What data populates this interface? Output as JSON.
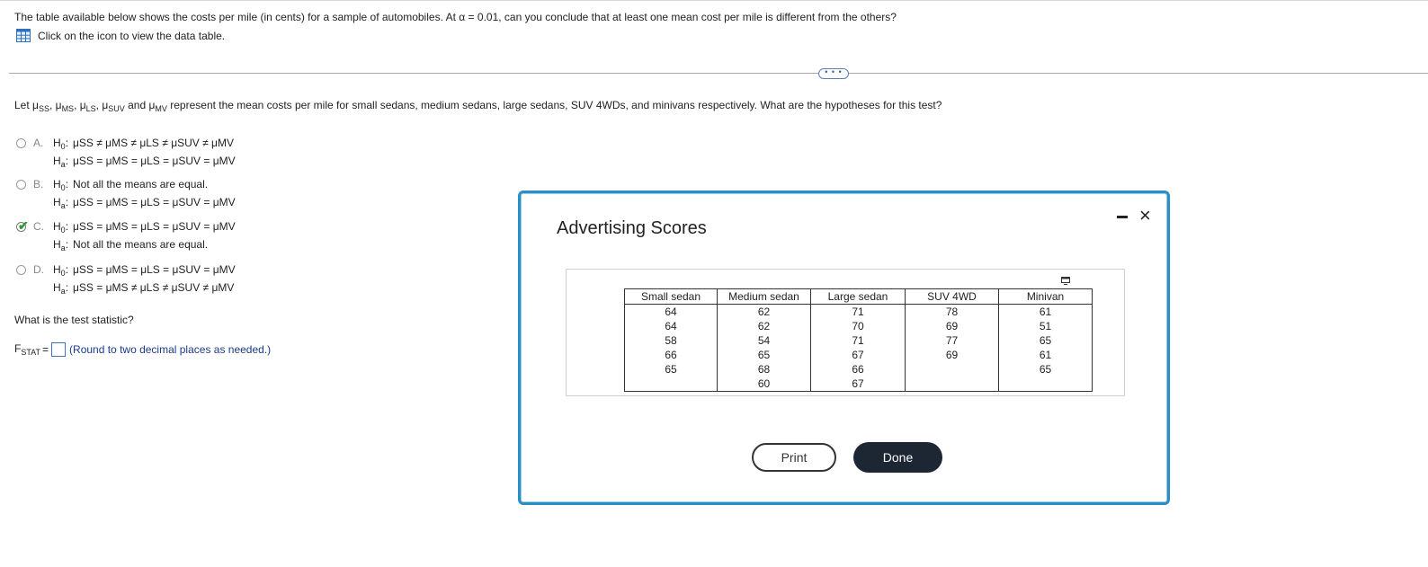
{
  "question": {
    "prefix": "The table available below shows the costs per mile (in cents) for a sample of automobiles. At",
    "alpha_symbol": "α",
    "alpha_value": "= 0.01, can you conclude that at least one mean cost per mile is different from the others?",
    "table_link": "Click on the icon to view the data table."
  },
  "let_line": {
    "start": "Let",
    "mu": "μ",
    "subs": [
      "SS",
      "MS",
      "LS",
      "SUV",
      "MV"
    ],
    "and": "and",
    "rest": "represent the mean costs per mile for small sedans, medium sedans, large sedans, SUV 4WDs, and minivans respectively. What are the hypotheses for this test?"
  },
  "options": [
    {
      "letter": "A.",
      "h0": "μSS ≠ μMS ≠ μLS ≠ μSUV ≠ μMV",
      "ha": "μSS = μMS = μLS = μSUV = μMV",
      "selected": false
    },
    {
      "letter": "B.",
      "h0": "Not all the means are equal.",
      "ha": "μSS = μMS = μLS = μSUV = μMV",
      "selected": false
    },
    {
      "letter": "C.",
      "h0": "μSS = μMS = μLS = μSUV = μMV",
      "ha": "Not all the means are equal.",
      "selected": true
    },
    {
      "letter": "D.",
      "h0": "μSS = μMS = μLS = μSUV = μMV",
      "ha": "μSS = μMS ≠ μLS ≠ μSUV ≠ μMV",
      "selected": false
    }
  ],
  "hyp_labels": {
    "h0": "H",
    "h0_sub": "0",
    "ha": "H",
    "ha_sub": "a"
  },
  "test_statistic": {
    "question": "What is the test statistic?",
    "label": "F",
    "label_sub": "STAT",
    "equals": "=",
    "note": "(Round to two decimal places as needed.)"
  },
  "modal": {
    "title": "Advertising Scores",
    "columns": [
      "Small sedan",
      "Medium sedan",
      "Large sedan",
      "SUV 4WD",
      "Minivan"
    ],
    "rows": [
      [
        "64",
        "62",
        "71",
        "78",
        "61"
      ],
      [
        "64",
        "62",
        "70",
        "69",
        "51"
      ],
      [
        "58",
        "54",
        "71",
        "77",
        "65"
      ],
      [
        "66",
        "65",
        "67",
        "69",
        "61"
      ],
      [
        "65",
        "68",
        "66",
        "",
        "65"
      ],
      [
        "",
        "60",
        "67",
        "",
        ""
      ]
    ],
    "print_label": "Print",
    "done_label": "Done",
    "close_glyph": "×"
  },
  "colors": {
    "modal_border": "#2a8fc4",
    "check": "#2e9a3c",
    "note_text": "#1b3a8c",
    "done_bg": "#1c2733"
  },
  "icons": [
    "table-grid-icon",
    "ellipsis-icon",
    "checkmark-icon",
    "minimize-icon",
    "close-icon",
    "expand-icon"
  ]
}
